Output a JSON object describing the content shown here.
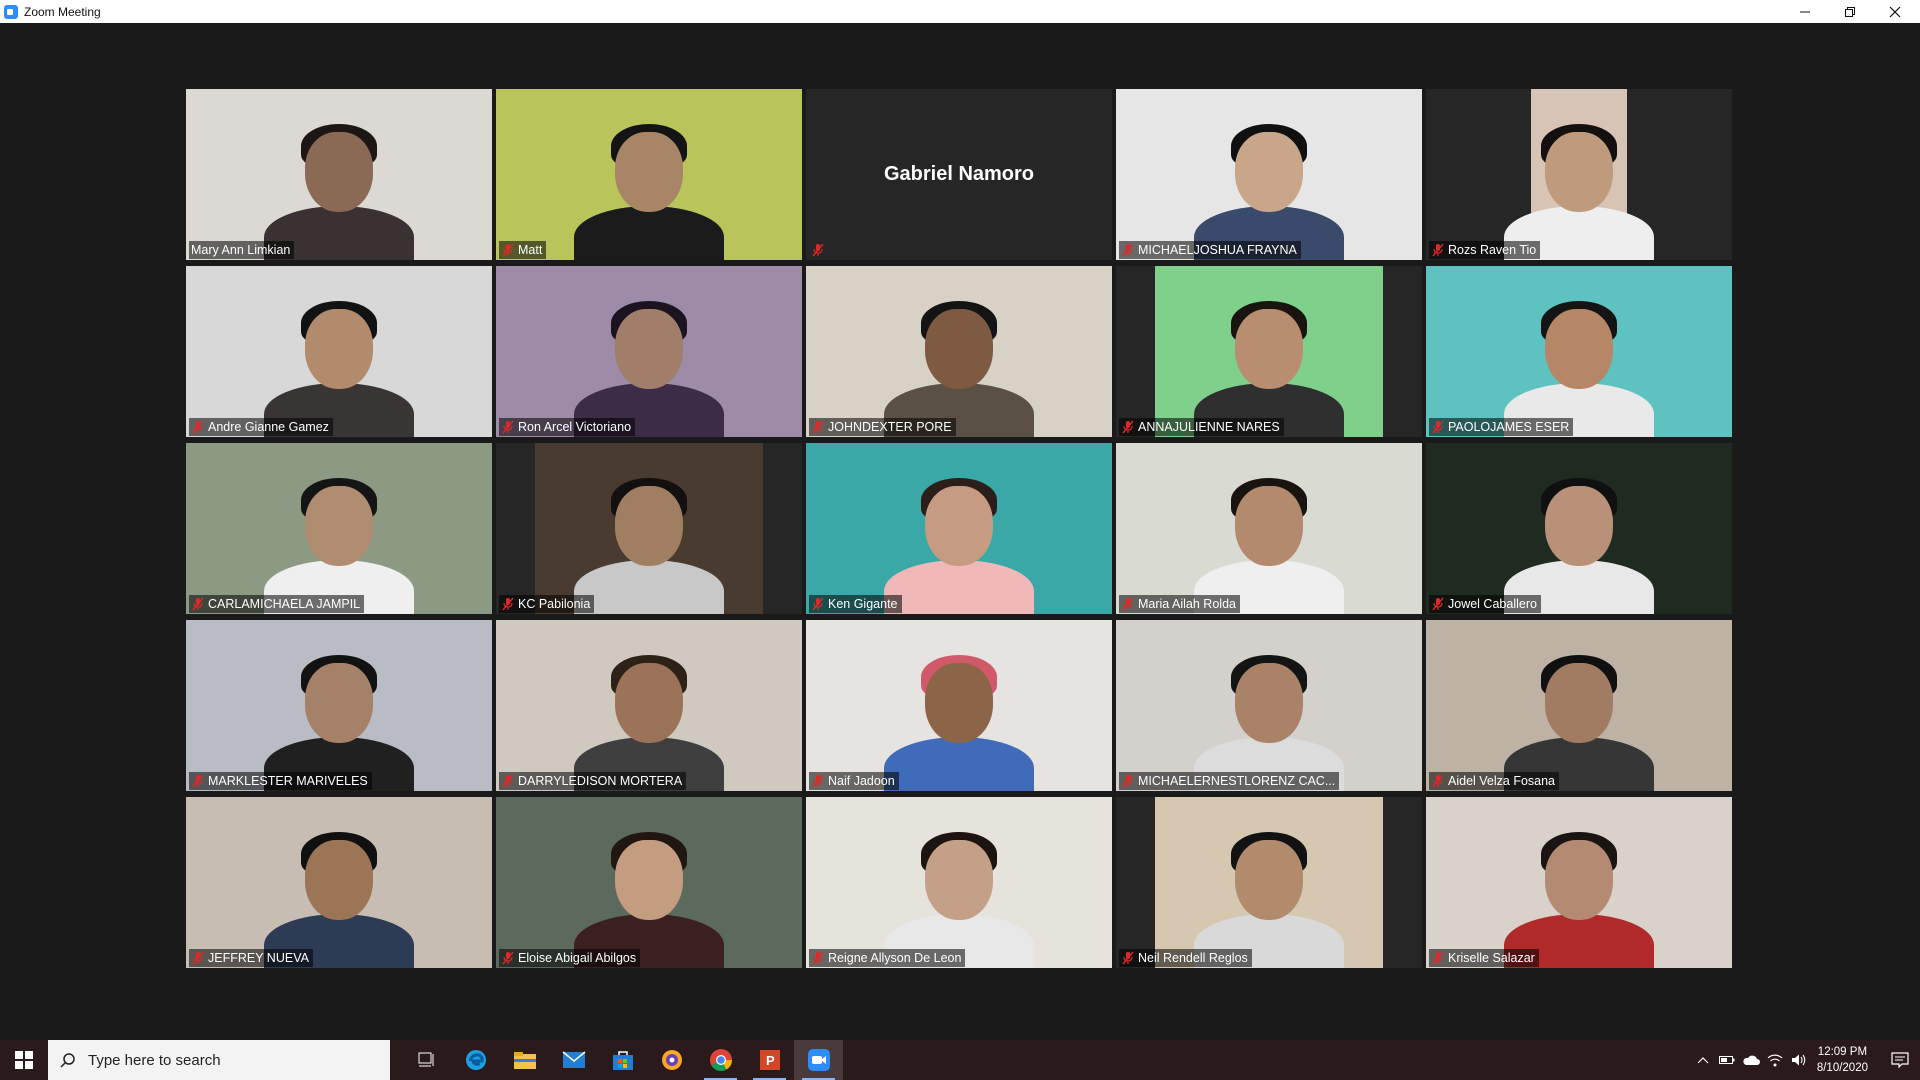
{
  "window": {
    "title": "Zoom Meeting",
    "colors": {
      "titlebar": "#ffffff",
      "background": "#1a1a1a",
      "active_speaker_border": "#e5f264",
      "mute": "#e02828"
    }
  },
  "participants": [
    {
      "name": "Mary Ann Limkian",
      "active": true,
      "muted": false,
      "video": {
        "wall": "#dcd9d4",
        "skin": "#8a6a55",
        "hair": "#1c1715",
        "shirt": "#3a3232"
      }
    },
    {
      "name": "Matt",
      "muted": true,
      "video": {
        "wall": "#b9c45a",
        "skin": "#a88566",
        "hair": "#141414",
        "shirt": "#1b1b1b"
      }
    },
    {
      "name": "",
      "center_name": "Gabriel Namoro",
      "muted": true,
      "video": null
    },
    {
      "name": "MICHAELJOSHUA FRAYNA",
      "muted": true,
      "video": {
        "wall": "#e6e6e6",
        "skin": "#c9a58a",
        "hair": "#101010",
        "shirt": "#3a4a6a"
      }
    },
    {
      "name": "Rozs Raven Tio",
      "muted": true,
      "narrow": true,
      "video": {
        "wall": "#d7c4b5",
        "skin": "#c09a7c",
        "hair": "#151010",
        "shirt": "#eeeeee"
      }
    },
    {
      "name": "Andre Gianne Gamez",
      "muted": true,
      "video": {
        "wall": "#d8d8d8",
        "skin": "#b28a6c",
        "hair": "#121212",
        "shirt": "#3a3535"
      }
    },
    {
      "name": "Ron Arcel Victoriano",
      "muted": true,
      "video": {
        "wall": "#9d8ba8",
        "skin": "#a07e6a",
        "hair": "#1b1420",
        "shirt": "#3d2c48"
      }
    },
    {
      "name": "JOHNDEXTER PORE",
      "muted": true,
      "video": {
        "wall": "#d8d1c6",
        "skin": "#7f5a42",
        "hair": "#141414",
        "shirt": "#5b5044"
      }
    },
    {
      "name": "ANNAJULIENNE NARES",
      "muted": true,
      "narrow": true,
      "video": {
        "wall": "#7fd08a",
        "skin": "#b88d70",
        "hair": "#1a1411",
        "shirt": "#2f2f2f"
      }
    },
    {
      "name": "PAOLOJAMES ESER",
      "muted": true,
      "video": {
        "wall": "#5ec3c0",
        "skin": "#b58766",
        "hair": "#141414",
        "shirt": "#e9e9e9"
      }
    },
    {
      "name": "CARLAMICHAELA JAMPIL",
      "muted": true,
      "video": {
        "wall": "#8d9a83",
        "skin": "#b08d70",
        "hair": "#151515",
        "shirt": "#efefef"
      }
    },
    {
      "name": "KC Pabilonia",
      "muted": true,
      "narrow": true,
      "video": {
        "wall": "#4a3b30",
        "skin": "#a07e62",
        "hair": "#141010",
        "shirt": "#c8c8c8"
      }
    },
    {
      "name": "Ken Gigante",
      "muted": true,
      "video": {
        "wall": "#39a8a6",
        "skin": "#c79b82",
        "hair": "#2a1f1a",
        "shirt": "#f0b8b8"
      }
    },
    {
      "name": "Maria Ailah Rolda",
      "muted": true,
      "video": {
        "wall": "#d9dbd2",
        "skin": "#b38a6e",
        "hair": "#1a1411",
        "shirt": "#efefef"
      }
    },
    {
      "name": "Jowel Caballero",
      "muted": true,
      "video": {
        "wall": "#1f2a20",
        "skin": "#b99178",
        "hair": "#101010",
        "shirt": "#e8e8e8"
      }
    },
    {
      "name": "MARKLESTER MARIVELES",
      "muted": true,
      "video": {
        "wall": "#b9bcc5",
        "skin": "#a6816a",
        "hair": "#121212",
        "shirt": "#202020"
      }
    },
    {
      "name": "DARRYLEDISON MORTERA",
      "muted": true,
      "video": {
        "wall": "#cfc9c0",
        "skin": "#9b7358",
        "hair": "#2d2118",
        "shirt": "#3f3f3f"
      }
    },
    {
      "name": "Naif Jadoon",
      "muted": true,
      "video": {
        "wall": "#e6e4e0",
        "skin": "#8c6448",
        "hair": "#d05a6a",
        "shirt": "#3f6bb8"
      }
    },
    {
      "name": "MICHAELERNESTLORENZ CAC...",
      "muted": true,
      "video": {
        "wall": "#d4d1cc",
        "skin": "#a98268",
        "hair": "#141414",
        "shirt": "#dcdcdc"
      }
    },
    {
      "name": "Aidel Velza Fosana",
      "muted": true,
      "video": {
        "wall": "#bdb2a4",
        "skin": "#a17c62",
        "hair": "#101010",
        "shirt": "#363636"
      }
    },
    {
      "name": "JEFFREY NUEVA",
      "muted": true,
      "video": {
        "wall": "#c8bdb2",
        "skin": "#9c7456",
        "hair": "#101010",
        "shirt": "#2d3b55"
      }
    },
    {
      "name": "Eloise Abigail Abilgos",
      "muted": true,
      "video": {
        "wall": "#5b6a5c",
        "skin": "#c49c80",
        "hair": "#201612",
        "shirt": "#3a2020"
      }
    },
    {
      "name": "Reigne Allyson De Leon",
      "muted": true,
      "video": {
        "wall": "#e6e2dc",
        "skin": "#c4a088",
        "hair": "#1b1411",
        "shirt": "#e8e8e8"
      }
    },
    {
      "name": "Neil Rendell Reglos",
      "muted": true,
      "narrow": true,
      "video": {
        "wall": "#d6c8b0",
        "skin": "#b28a6c",
        "hair": "#121212",
        "shirt": "#d9d9d9"
      }
    },
    {
      "name": "Kriselle Salazar",
      "muted": true,
      "video": {
        "wall": "#d8d2ca",
        "skin": "#b48a72",
        "hair": "#1a1412",
        "shirt": "#b02a2a"
      }
    }
  ],
  "taskbar": {
    "search_placeholder": "Type here to search",
    "time": "12:09 PM",
    "date": "8/10/2020",
    "apps": [
      "task-view",
      "edge",
      "file-explorer",
      "mail",
      "store",
      "vpn",
      "chrome",
      "powerpoint",
      "zoom"
    ]
  }
}
